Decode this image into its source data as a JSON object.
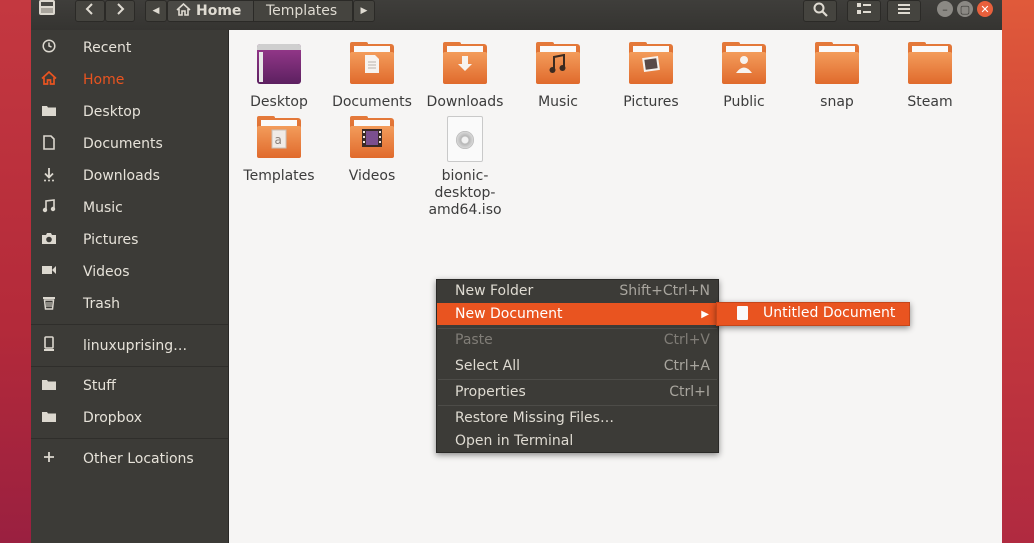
{
  "window": {
    "path": {
      "home_label": "Home",
      "current_label": "Templates"
    }
  },
  "icons": {
    "back": "chevron-left-icon",
    "forward": "chevron-right-icon",
    "search": "search-icon",
    "view": "view-toggle-icon",
    "menu": "hamburger-menu-icon"
  },
  "sidebar": {
    "items": [
      {
        "label": "Recent",
        "icon": "clock-icon"
      },
      {
        "label": "Home",
        "icon": "home-icon",
        "active": true
      },
      {
        "label": "Desktop",
        "icon": "folder-icon"
      },
      {
        "label": "Documents",
        "icon": "document-icon"
      },
      {
        "label": "Downloads",
        "icon": "download-icon"
      },
      {
        "label": "Music",
        "icon": "music-icon"
      },
      {
        "label": "Pictures",
        "icon": "camera-icon"
      },
      {
        "label": "Videos",
        "icon": "video-icon"
      },
      {
        "label": "Trash",
        "icon": "trash-icon"
      },
      {
        "label": "linuxuprising…",
        "icon": "drive-icon"
      },
      {
        "label": "Stuff",
        "icon": "folder-icon"
      },
      {
        "label": "Dropbox",
        "icon": "folder-icon"
      },
      {
        "label": "Other Locations",
        "icon": "plus-icon"
      }
    ]
  },
  "files": [
    {
      "label": "Desktop"
    },
    {
      "label": "Documents"
    },
    {
      "label": "Downloads"
    },
    {
      "label": "Music"
    },
    {
      "label": "Pictures"
    },
    {
      "label": "Public"
    },
    {
      "label": "snap"
    },
    {
      "label": "Steam"
    },
    {
      "label": "Templates"
    },
    {
      "label": "Videos"
    },
    {
      "label": "bionic-desktop-amd64.iso",
      "line1": "bionic-",
      "line2": "desktop-",
      "line3": "amd64.iso"
    }
  ],
  "context_menu": {
    "items": [
      {
        "label": "New Folder",
        "accel": "Shift+Ctrl+N"
      },
      {
        "label": "New Document"
      },
      {
        "label": "Paste",
        "accel": "Ctrl+V"
      },
      {
        "label": "Select All",
        "accel": "Ctrl+A"
      },
      {
        "label": "Properties",
        "accel": "Ctrl+I"
      },
      {
        "label": "Restore Missing Files…"
      },
      {
        "label": "Open in Terminal"
      }
    ]
  },
  "submenu": {
    "items": [
      {
        "label": "Untitled Document"
      }
    ]
  },
  "colors": {
    "accent": "#e95420",
    "sidebar_bg": "#3c3b37",
    "content_bg": "#f6f5f4"
  }
}
